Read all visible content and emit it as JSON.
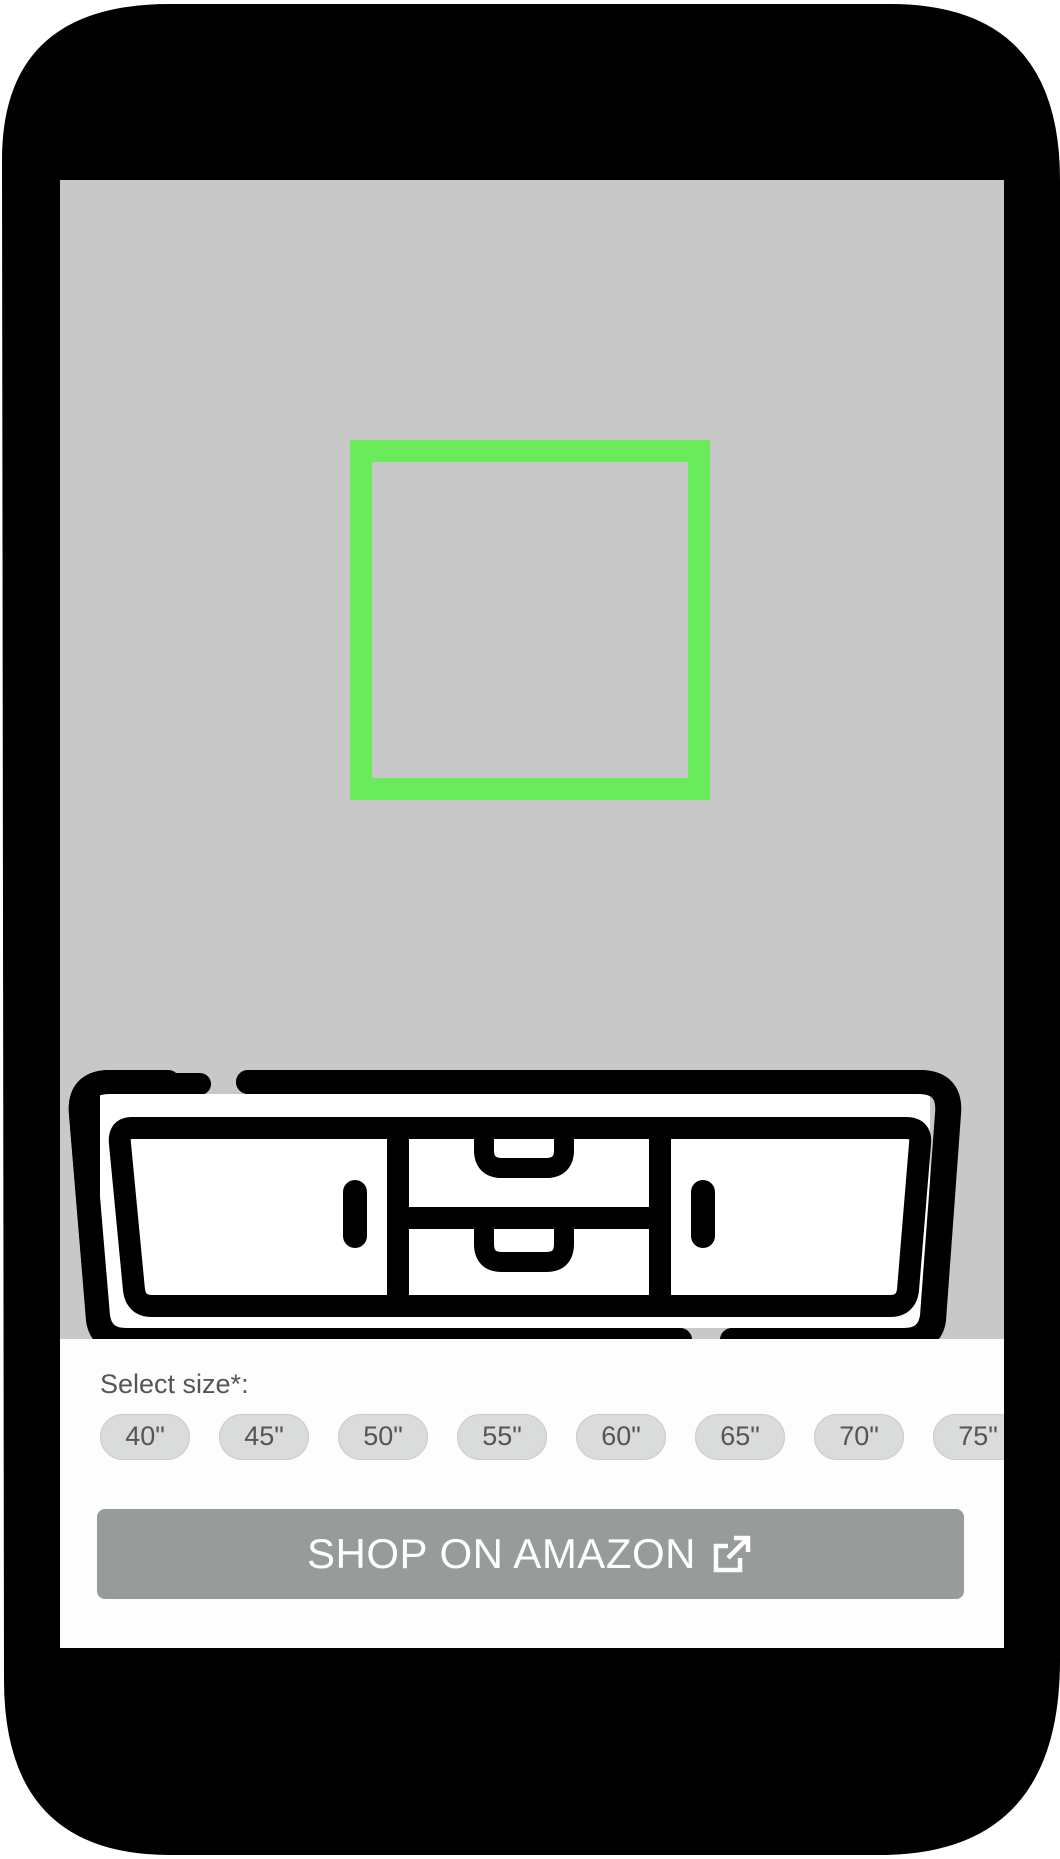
{
  "panel": {
    "size_label": "Select size*:",
    "sizes": [
      "40\"",
      "45\"",
      "50\"",
      "55\"",
      "60\"",
      "65\"",
      "70\"",
      "75\""
    ],
    "shop_button": "SHOP ON AMAZON"
  },
  "icons": {
    "button_icon": "external-link-icon",
    "pointer": "hand-pointer-icon",
    "furniture": "tv-stand-icon",
    "placement": "placement-frame-icon"
  },
  "colors": {
    "frame": "#69eb5b",
    "button": "#979b9a",
    "chip": "#d9dcdb",
    "screen": "#c8c8c8"
  }
}
